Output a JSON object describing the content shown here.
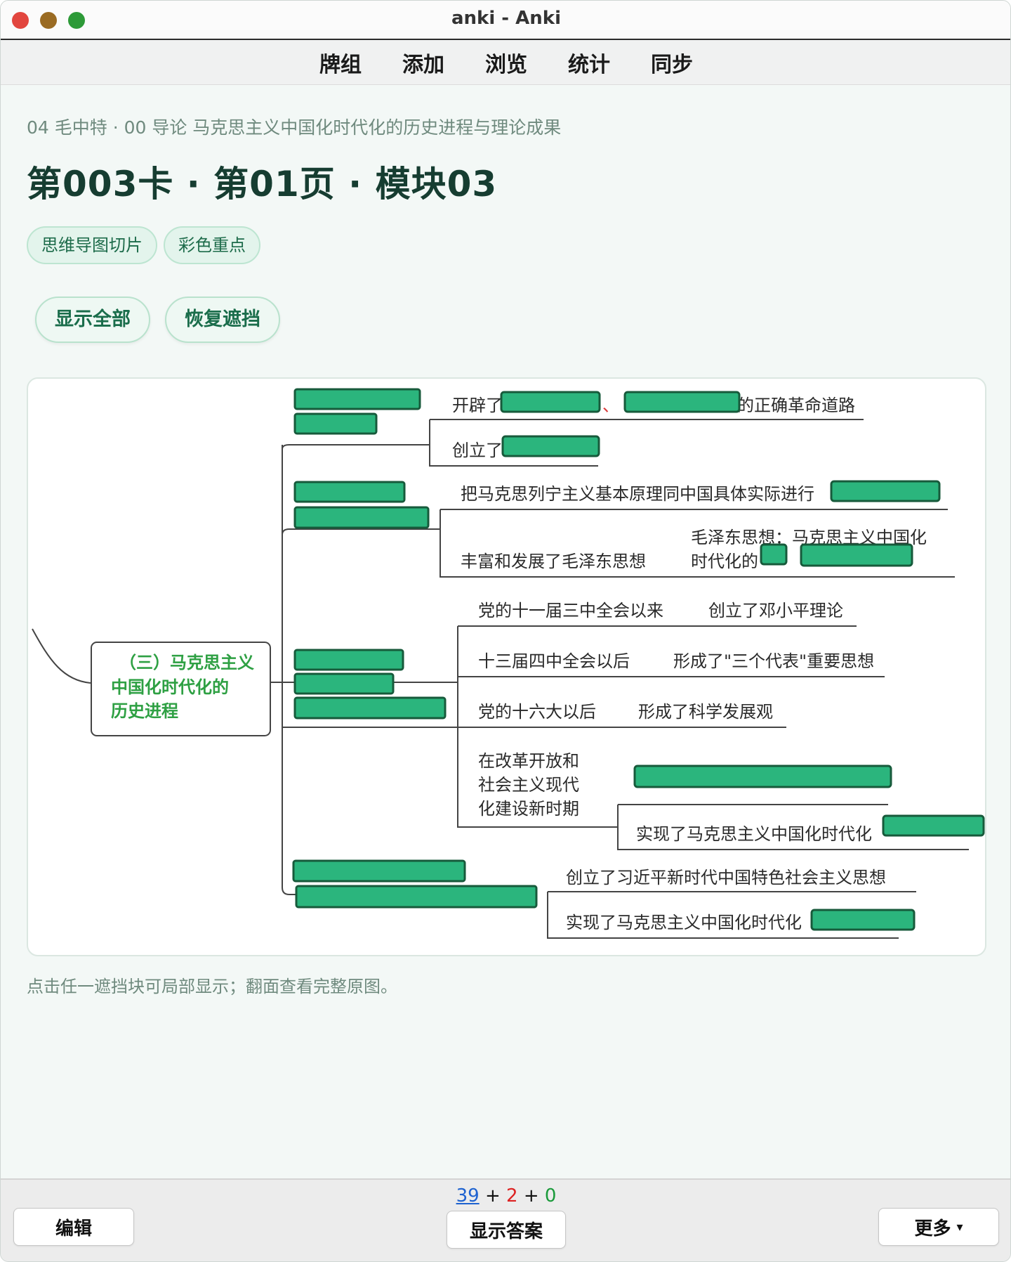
{
  "window": {
    "title": "anki - Anki"
  },
  "menu": {
    "decks": "牌组",
    "add": "添加",
    "browse": "浏览",
    "stats": "统计",
    "sync": "同步"
  },
  "card": {
    "breadcrumb": "04 毛中特 · 00 导论 马克思主义中国化时代化的历史进程与理论成果",
    "title": "第003卡 · 第01页 · 模块03",
    "tags": [
      "思维导图切片",
      "彩色重点"
    ],
    "show_all": "显示全部",
    "restore": "恢复遮挡",
    "hint": "点击任一遮挡块可局部显示；翻面查看完整原图。"
  },
  "mindmap": {
    "root": [
      "（三）马克思主义",
      "中国化时代化的",
      "历史进程"
    ],
    "b1_line1": "开辟了",
    "b1_comma": "、",
    "b1_suffix": "的正确革命道路",
    "b1_line2": "创立了",
    "b2_line1": "把马克思列宁主义基本原理同中国具体实际进行",
    "b2_line2": "丰富和发展了毛泽东思想",
    "b2_side1": "毛泽东思想：马克思主义中国化",
    "b2_side2": "时代化的",
    "b3_1a": "党的十一届三中全会以来",
    "b3_1b": "创立了邓小平理论",
    "b3_2a": "十三届四中全会以后",
    "b3_2b": "形成了\"三个代表\"重要思想",
    "b3_3a": "党的十六大以后",
    "b3_3b": "形成了科学发展观",
    "b3_4": [
      "在改革开放和",
      "社会主义现代",
      "化建设新时期"
    ],
    "b3_5": "实现了马克思主义中国化时代化",
    "b4_1": "创立了习近平新时代中国特色社会主义思想",
    "b4_2": "实现了马克思主义中国化时代化"
  },
  "footer": {
    "count_new": "39",
    "count_learn": "2",
    "count_review": "0",
    "plus": "+",
    "edit": "编辑",
    "show_answer": "显示答案",
    "more": "更多",
    "more_caret": "▾"
  },
  "colors": {
    "occlusion": "#2bb57d",
    "accent": "#1a6d4b",
    "root_text": "#2ea043"
  }
}
